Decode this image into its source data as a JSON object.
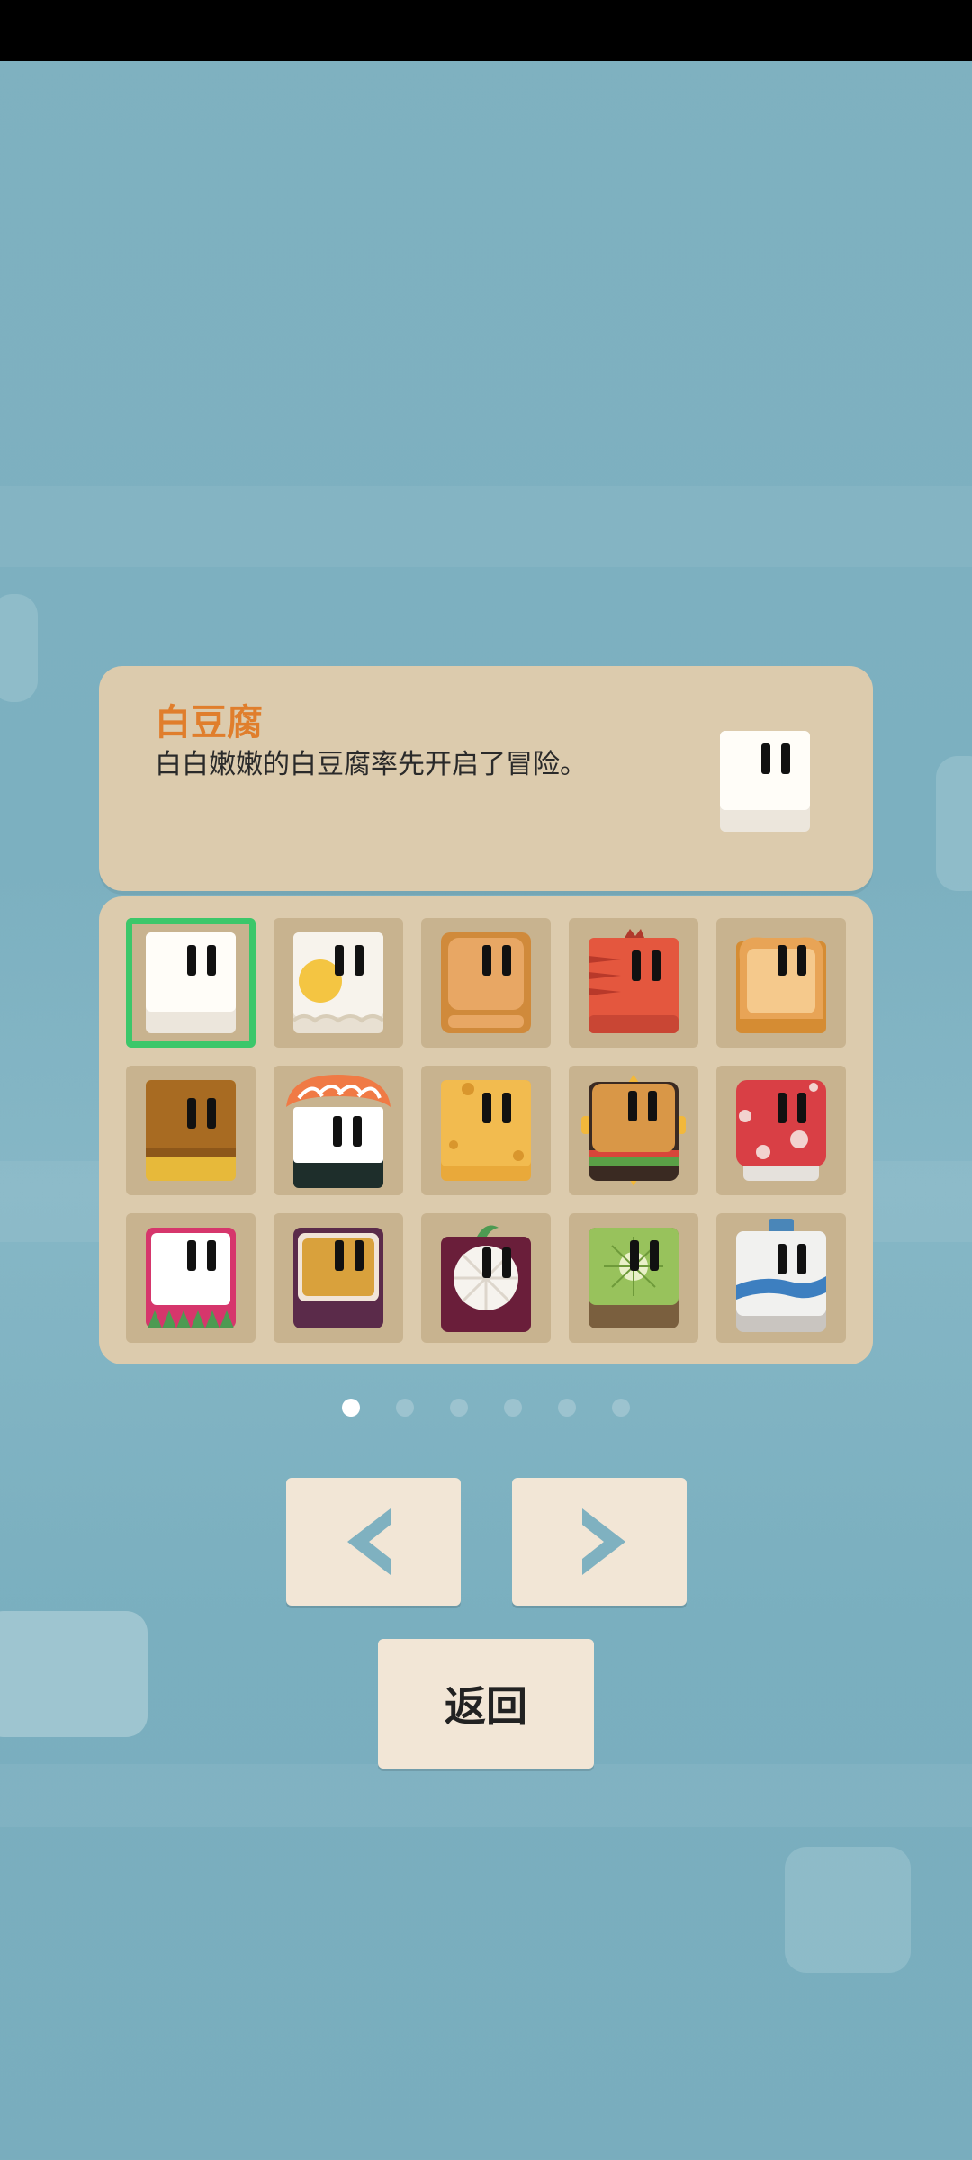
{
  "character": {
    "name": "白豆腐",
    "description": "白白嫩嫩的白豆腐率先开启了冒险。"
  },
  "colors": {
    "title": "#e07e2c",
    "panel": "#dccbad",
    "slot": "#c8b38f",
    "selected_border": "#3cc76a",
    "button": "#f2e6d6",
    "arrow": "#7fb1c0"
  },
  "grid": {
    "selected_index": 0,
    "items": [
      {
        "icon": "white-tofu-icon"
      },
      {
        "icon": "fried-egg-icon"
      },
      {
        "icon": "fried-tofu-icon"
      },
      {
        "icon": "crayfish-icon"
      },
      {
        "icon": "toast-bread-icon"
      },
      {
        "icon": "pudding-icon"
      },
      {
        "icon": "salmon-sushi-icon"
      },
      {
        "icon": "cheese-icon"
      },
      {
        "icon": "sandwich-icon"
      },
      {
        "icon": "strawberry-cake-icon"
      },
      {
        "icon": "dragon-fruit-icon"
      },
      {
        "icon": "passion-fruit-icon"
      },
      {
        "icon": "mangosteen-icon"
      },
      {
        "icon": "kiwi-icon"
      },
      {
        "icon": "milk-bottle-icon"
      }
    ]
  },
  "pagination": {
    "current": 1,
    "total": 6
  },
  "buttons": {
    "prev_icon": "chevron-left-icon",
    "next_icon": "chevron-right-icon",
    "back_label": "返回"
  }
}
